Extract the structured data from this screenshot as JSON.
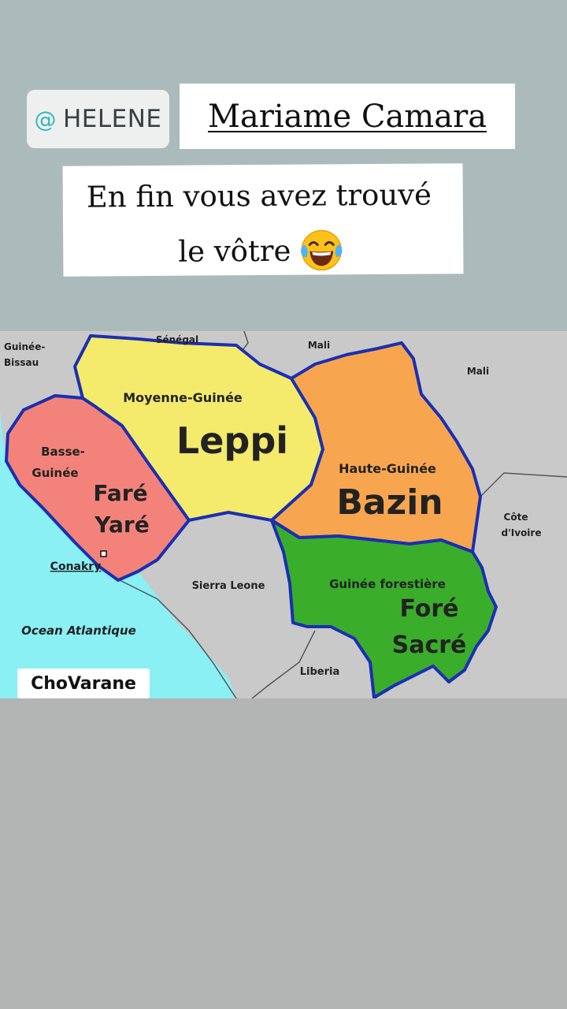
{
  "story": {
    "mention_handle": "HELENE",
    "mention_symbol": "@",
    "title": "Mariame Camara",
    "caption_line1": "En fin vous avez trouvé",
    "caption_line2": "le vôtre",
    "caption_emoji": "face-with-tears-of-joy-icon"
  },
  "map": {
    "watermark": "ChoVarane",
    "neighbors": {
      "guinea_bissau_1": "Guinée-",
      "guinea_bissau_2": "Bissau",
      "senegal": "Sénégal",
      "mali_1": "Mali",
      "mali_2": "Mali",
      "cote_ivoire_1": "Côte",
      "cote_ivoire_2": "d'Ivoire",
      "sierra_leone": "Sierra Leone",
      "liberia": "Liberia",
      "ocean": "Ocean Atlantique",
      "capital": "Conakry"
    },
    "regions": {
      "moyenne": {
        "name": "Moyenne-Guinée",
        "nickname": "Leppi",
        "color": "#f4ea6c"
      },
      "basse": {
        "name_1": "Basse-",
        "name_2": "Guinée",
        "nickname_1": "Faré",
        "nickname_2": "Yaré",
        "color": "#f3837a"
      },
      "haute": {
        "name": "Haute-Guinée",
        "nickname": "Bazin",
        "color": "#f7a64f"
      },
      "forestiere": {
        "name": "Guinée forestière",
        "nickname_1": "Foré",
        "nickname_2": "Sacré",
        "color": "#3aad2b"
      }
    },
    "colors": {
      "ocean": "#8af0f4",
      "land": "#c9c9c9",
      "border": "#1b2fb0"
    }
  }
}
